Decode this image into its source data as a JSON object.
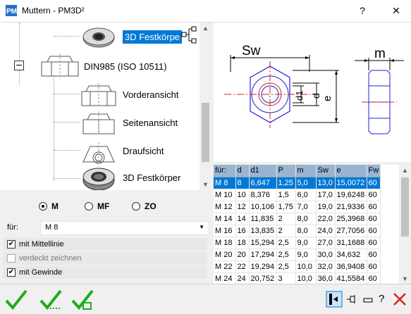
{
  "window": {
    "title": "Muttern  -  PM3D²",
    "help_label": "?",
    "close_label": "✕",
    "app_icon": "pm3d-icon"
  },
  "tree": {
    "items": [
      {
        "label": "3D Festkörpe",
        "icon": "nut-3d-thumbnail",
        "selected": true
      },
      {
        "label": "DIN985 (ISO 10511)",
        "icon": "nut-side-thumbnail",
        "selected": false
      },
      {
        "label": "Vorderansicht",
        "icon": "nut-front-view-thumbnail",
        "selected": false
      },
      {
        "label": "Seitenansicht",
        "icon": "nut-side-view-thumbnail",
        "selected": false
      },
      {
        "label": "Draufsicht",
        "icon": "nut-top-view-thumbnail",
        "selected": false
      },
      {
        "label": "3D Festkörper",
        "icon": "nut-3d-thumbnail",
        "selected": false
      }
    ]
  },
  "drawing": {
    "sw_label": "Sw",
    "m_label": "m",
    "d1_label": "d1",
    "d_label": "d",
    "e_label": "e"
  },
  "table": {
    "columns": [
      "für:",
      "d",
      "d1",
      "P",
      "m",
      "Sw",
      "e",
      "Fw"
    ],
    "rows": [
      [
        "M 8",
        "8",
        "6,647",
        "1,25",
        "5,0",
        "13,0",
        "15,0072",
        "60"
      ],
      [
        "M 10",
        "10",
        "8,376",
        "1,5",
        "6,0",
        "17,0",
        "19,6248",
        "60"
      ],
      [
        "M 12",
        "12",
        "10,106",
        "1,75",
        "7,0",
        "19,0",
        "21,9336",
        "60"
      ],
      [
        "M 14",
        "14",
        "11,835",
        "2",
        "8,0",
        "22,0",
        "25,3968",
        "60"
      ],
      [
        "M 16",
        "16",
        "13,835",
        "2",
        "8,0",
        "24,0",
        "27,7056",
        "60"
      ],
      [
        "M 18",
        "18",
        "15,294",
        "2,5",
        "9,0",
        "27,0",
        "31,1688",
        "60"
      ],
      [
        "M 20",
        "20",
        "17,294",
        "2,5",
        "9,0",
        "30,0",
        "34,632",
        "60"
      ],
      [
        "M 22",
        "22",
        "19,294",
        "2,5",
        "10,0",
        "32,0",
        "36,9408",
        "60"
      ],
      [
        "M 24",
        "24",
        "20,752",
        "3",
        "10,0",
        "36,0",
        "41,5584",
        "60"
      ]
    ],
    "selected_row": 0
  },
  "options": {
    "radios": [
      {
        "label": "M",
        "checked": true
      },
      {
        "label": "MF",
        "checked": false
      },
      {
        "label": "ZO",
        "checked": false
      }
    ],
    "fuer_label": "für:",
    "fuer_value": "M 8",
    "checks": [
      {
        "label": "mit Mittellinie",
        "checked": true,
        "enabled": true
      },
      {
        "label": "verdeckt zeichnen",
        "checked": false,
        "enabled": false
      },
      {
        "label": "mit Gewinde",
        "checked": true,
        "enabled": true
      }
    ]
  },
  "bottom": {
    "left_icons": [
      "ok-check-icon",
      "ok-repeat-check-icon",
      "ok-window-check-icon"
    ],
    "right_icons": [
      "dock-panel-icon",
      "pin-icon",
      "minimize-icon",
      "help-icon",
      "close-icon"
    ],
    "help_glyph": "?"
  },
  "colors": {
    "accent": "#0078d7",
    "check_green": "#22aa22",
    "close_red": "#e0201f"
  }
}
